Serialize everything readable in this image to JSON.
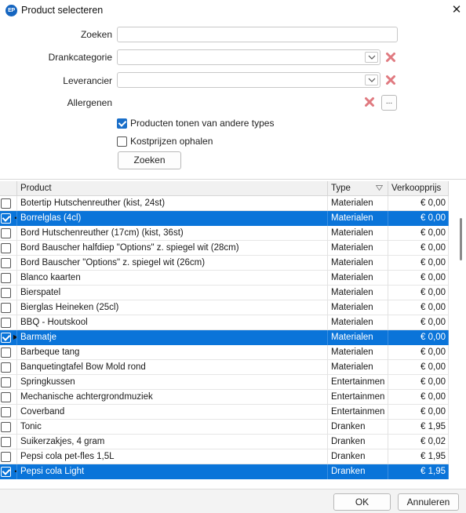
{
  "window": {
    "icon_text": "EP",
    "title": "Product selecteren",
    "close_glyph": "✕"
  },
  "filters": {
    "search_label": "Zoeken",
    "search_value": "",
    "category_label": "Drankcategorie",
    "category_value": "",
    "supplier_label": "Leverancier",
    "supplier_value": "",
    "allergens_label": "Allergenen",
    "ellipsis_label": "...",
    "show_other_types_label": "Producten tonen van andere types",
    "show_other_types_checked": true,
    "cost_prices_label": "Kostprijzen ophalen",
    "cost_prices_checked": false,
    "search_button": "Zoeken"
  },
  "grid": {
    "columns": [
      "Product",
      "Type",
      "Verkoopprijs"
    ],
    "rows": [
      {
        "product": "Botertip Hutschenreuther (kist, 24st)",
        "type": "Materialen",
        "price": "€ 0,00",
        "checked": false,
        "selected": false,
        "marker": ""
      },
      {
        "product": "Borrelglas (4cl)",
        "type": "Materialen",
        "price": "€ 0,00",
        "checked": true,
        "selected": true,
        "marker": "•"
      },
      {
        "product": "Bord Hutschenreuther (17cm) (kist, 36st)",
        "type": "Materialen",
        "price": "€ 0,00",
        "checked": false,
        "selected": false,
        "marker": ""
      },
      {
        "product": "Bord Bauscher halfdiep \"Options\" z. spiegel wit (28cm)",
        "type": "Materialen",
        "price": "€ 0,00",
        "checked": false,
        "selected": false,
        "marker": ""
      },
      {
        "product": "Bord Bauscher \"Options\" z. spiegel wit (26cm)",
        "type": "Materialen",
        "price": "€ 0,00",
        "checked": false,
        "selected": false,
        "marker": ""
      },
      {
        "product": "Blanco kaarten",
        "type": "Materialen",
        "price": "€ 0,00",
        "checked": false,
        "selected": false,
        "marker": ""
      },
      {
        "product": "Bierspatel",
        "type": "Materialen",
        "price": "€ 0,00",
        "checked": false,
        "selected": false,
        "marker": ""
      },
      {
        "product": "Bierglas Heineken (25cl)",
        "type": "Materialen",
        "price": "€ 0,00",
        "checked": false,
        "selected": false,
        "marker": ""
      },
      {
        "product": "BBQ - Houtskool",
        "type": "Materialen",
        "price": "€ 0,00",
        "checked": false,
        "selected": false,
        "marker": ""
      },
      {
        "product": "Barmatje",
        "type": "Materialen",
        "price": "€ 0,00",
        "checked": true,
        "selected": true,
        "marker": "▶"
      },
      {
        "product": "Barbeque tang",
        "type": "Materialen",
        "price": "€ 0,00",
        "checked": false,
        "selected": false,
        "marker": ""
      },
      {
        "product": "Banquetingtafel Bow Mold rond",
        "type": "Materialen",
        "price": "€ 0,00",
        "checked": false,
        "selected": false,
        "marker": ""
      },
      {
        "product": "Springkussen",
        "type": "Entertainmen",
        "price": "€ 0,00",
        "checked": false,
        "selected": false,
        "marker": ""
      },
      {
        "product": "Mechanische achtergrondmuziek",
        "type": "Entertainmen",
        "price": "€ 0,00",
        "checked": false,
        "selected": false,
        "marker": ""
      },
      {
        "product": "Coverband",
        "type": "Entertainmen",
        "price": "€ 0,00",
        "checked": false,
        "selected": false,
        "marker": ""
      },
      {
        "product": "Tonic",
        "type": "Dranken",
        "price": "€ 1,95",
        "checked": false,
        "selected": false,
        "marker": ""
      },
      {
        "product": "Suikerzakjes, 4 gram",
        "type": "Dranken",
        "price": "€ 0,02",
        "checked": false,
        "selected": false,
        "marker": ""
      },
      {
        "product": "Pepsi cola pet-fles 1,5L",
        "type": "Dranken",
        "price": "€ 1,95",
        "checked": false,
        "selected": false,
        "marker": ""
      },
      {
        "product": "Pepsi cola Light",
        "type": "Dranken",
        "price": "€ 1,95",
        "checked": true,
        "selected": true,
        "marker": "•"
      }
    ]
  },
  "footer": {
    "ok_label": "OK",
    "cancel_label": "Annuleren"
  },
  "colors": {
    "selection": "#0a74d9",
    "accent": "#1a6fc9",
    "clear_icon": "#e07a80"
  }
}
